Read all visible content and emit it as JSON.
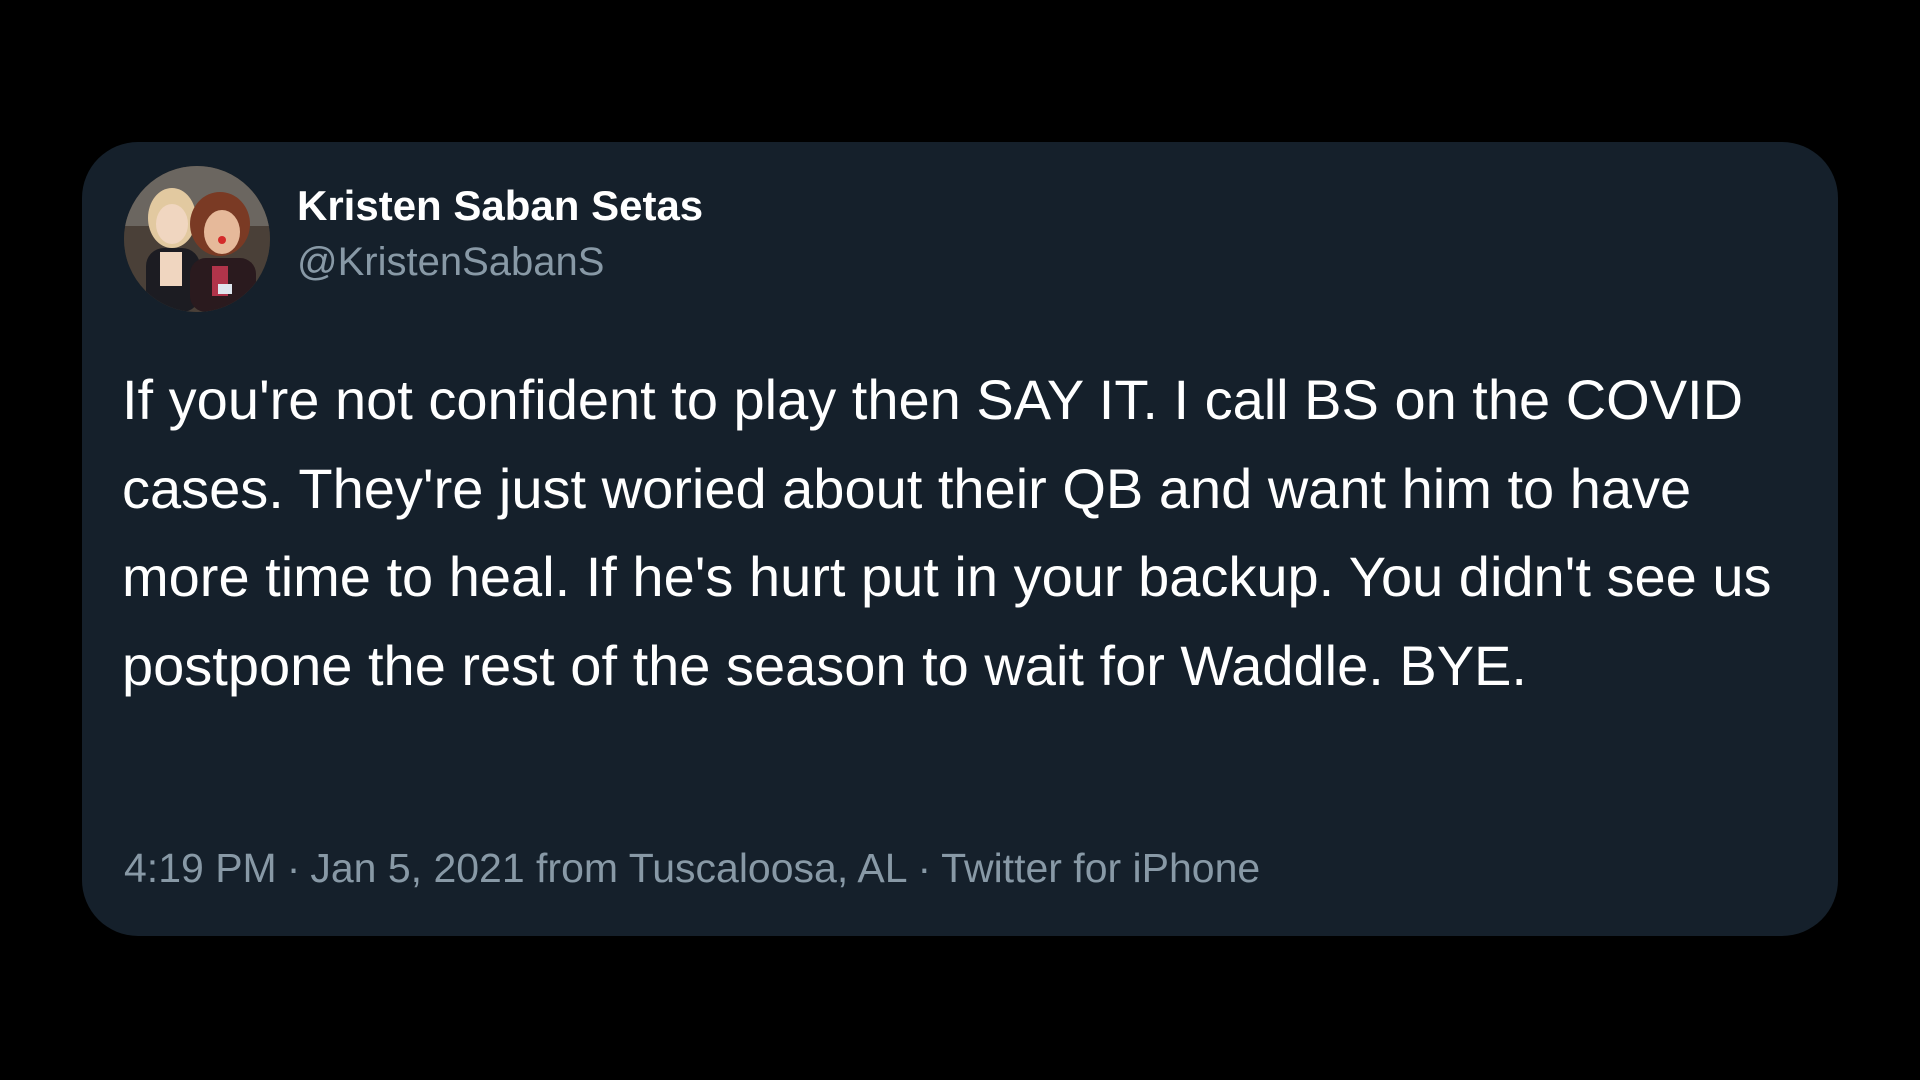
{
  "tweet": {
    "author": {
      "display_name": "Kristen Saban Setas",
      "handle": "@KristenSabanS",
      "avatar_icon": "profile-photo-two-women"
    },
    "text": "If you're not confident to play then SAY IT. I call BS on the COVID cases. They're just woried about their QB and want him to have more time to heal. If he's hurt put in your backup. You didn't see us postpone the rest of the season to wait for Waddle. BYE.",
    "meta": {
      "time": "4:19 PM",
      "date_location": "Jan 5, 2021 from Tuscaloosa, AL",
      "separator": "·",
      "source": "Twitter for iPhone"
    }
  },
  "colors": {
    "page_background": "#000000",
    "card_background": "#15202b",
    "primary_text": "#ffffff",
    "secondary_text": "#8899a6"
  }
}
